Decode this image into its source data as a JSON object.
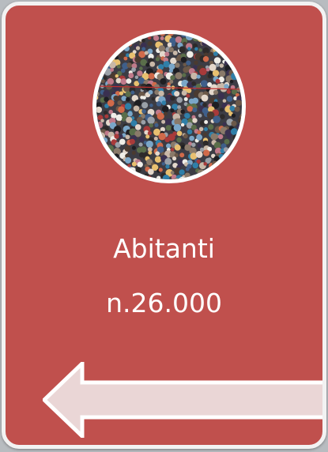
{
  "card": {
    "title": "Abitanti",
    "value": "n.26.000",
    "background_color": "#c0504d",
    "image_icon": "crowd-photo-icon",
    "nav_icon": "arrow-left-icon"
  }
}
